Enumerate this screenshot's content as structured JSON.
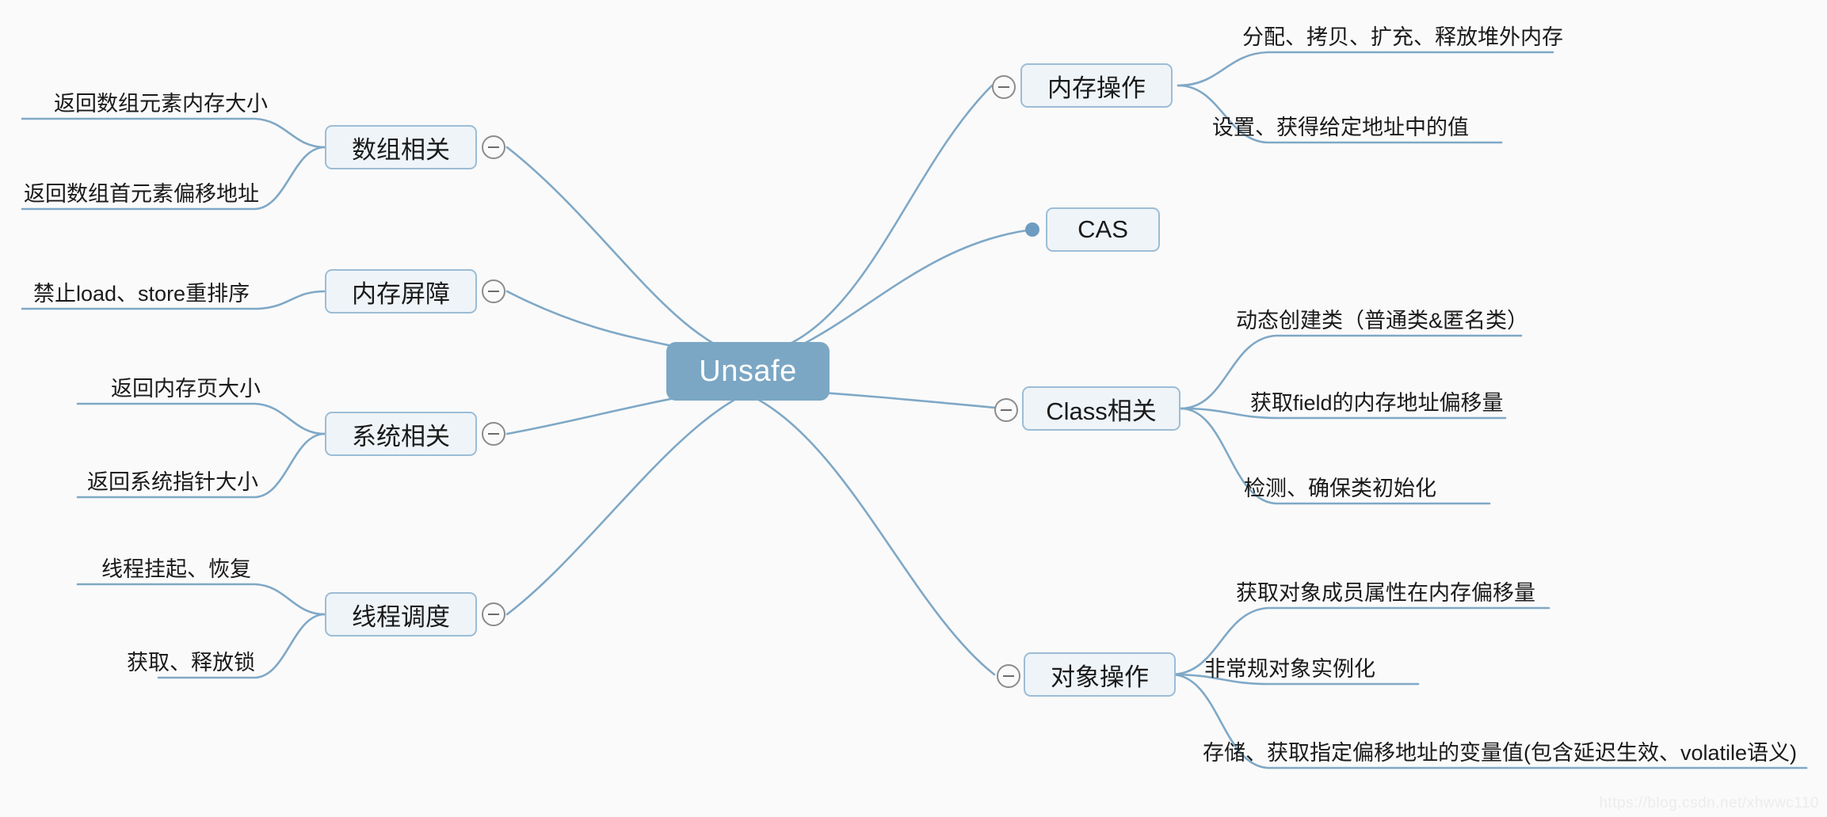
{
  "root": {
    "label": "Unsafe"
  },
  "colors": {
    "canvas_bg": "#fafafa",
    "root_fill": "#7BA7C4",
    "root_text": "#ffffff",
    "branch_fill": "#EFF4F8",
    "branch_border": "#9CBDD6",
    "edge": "#7FA8C6",
    "toggle_border": "#8c8c8c",
    "leaf_text": "#1a1a1a",
    "watermark": "#ececec"
  },
  "branches": {
    "array": {
      "label": "数组相关",
      "side": "left",
      "toggle": "collapse-toggle",
      "leaves": [
        {
          "label": "返回数组元素内存大小"
        },
        {
          "label": "返回数组首元素偏移地址"
        }
      ]
    },
    "memory_barrier": {
      "label": "内存屏障",
      "side": "left",
      "toggle": "collapse-toggle",
      "leaves": [
        {
          "label": "禁止load、store重排序"
        }
      ]
    },
    "system": {
      "label": "系统相关",
      "side": "left",
      "toggle": "collapse-toggle",
      "leaves": [
        {
          "label": "返回内存页大小"
        },
        {
          "label": "返回系统指针大小"
        }
      ]
    },
    "thread": {
      "label": "线程调度",
      "side": "left",
      "toggle": "collapse-toggle",
      "leaves": [
        {
          "label": "线程挂起、恢复"
        },
        {
          "label": "获取、释放锁"
        }
      ]
    },
    "memory_ops": {
      "label": "内存操作",
      "side": "right",
      "toggle": "collapse-toggle",
      "leaves": [
        {
          "label": "分配、拷贝、扩充、释放堆外内存"
        },
        {
          "label": "设置、获得给定地址中的值"
        }
      ]
    },
    "cas": {
      "label": "CAS",
      "side": "right",
      "toggle": "leaf-dot",
      "leaves": []
    },
    "class_related": {
      "label": "Class相关",
      "side": "right",
      "toggle": "collapse-toggle",
      "leaves": [
        {
          "label": "动态创建类（普通类&匿名类）"
        },
        {
          "label": "获取field的内存地址偏移量"
        },
        {
          "label": "检测、确保类初始化"
        }
      ]
    },
    "object_ops": {
      "label": "对象操作",
      "side": "right",
      "toggle": "collapse-toggle",
      "leaves": [
        {
          "label": "获取对象成员属性在内存偏移量"
        },
        {
          "label": "非常规对象实例化"
        },
        {
          "label": "存储、获取指定偏移地址的变量值(包含延迟生效、volatile语义)"
        }
      ]
    }
  },
  "watermark": {
    "text": "https://blog.csdn.net/xhwwc110"
  }
}
